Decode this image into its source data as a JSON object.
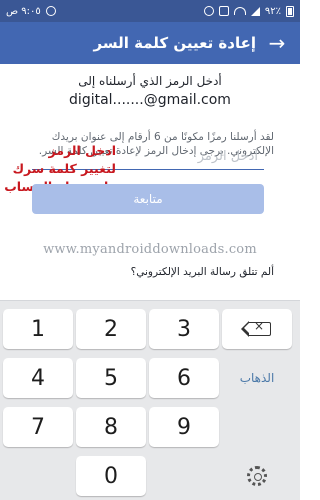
{
  "status_bar": {
    "time": "٩:٠٥ ص",
    "battery": "٩٢٪"
  },
  "header": {
    "title": "إعادة تعيين كلمة السر"
  },
  "content": {
    "prompt": "أدخل الرمز الذي أرسلناه إلى",
    "email": "digital.......@gmail.com",
    "sent_info": "لقد أرسلنا رمزًا مكونًا من 6 أرقام إلى عنوان بريدك الإلكتروني. يرجى إدخال الرمز لإعادة تعيين كلمة السر.",
    "code_placeholder": "أدخل الرمز",
    "overlay_note": [
      "ادخل الرمز",
      "لتغيير كلمة سرك",
      "واسترجاع الحساب"
    ],
    "continue_label": "متابعة",
    "watermark": "www.myandroiddownloads.com",
    "no_email_link": "ألم تتلق رسالة البريد الإلكتروني؟"
  },
  "keyboard": {
    "keys": [
      "1",
      "2",
      "3",
      "4",
      "5",
      "6",
      "7",
      "8",
      "9",
      "0"
    ],
    "go_label": "الذهاب"
  },
  "colors": {
    "status_bar": "#3a5795",
    "header": "#4267b2",
    "button_disabled": "#a9bee8",
    "overlay_text": "#c8181f"
  }
}
